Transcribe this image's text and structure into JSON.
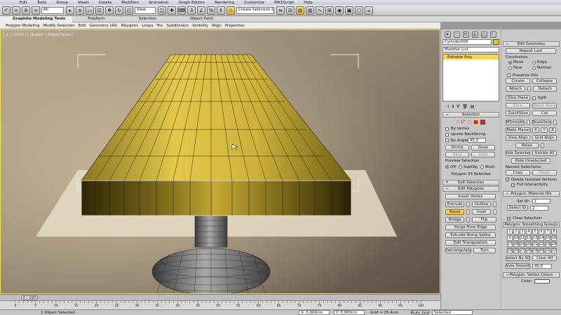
{
  "menu": [
    "Edit",
    "Tools",
    "Group",
    "Views",
    "Create",
    "Modifiers",
    "Animation",
    "Graph Editors",
    "Rendering",
    "Customize",
    "MAXScript",
    "Help"
  ],
  "toolbar": {
    "filter_select": "All",
    "coord_select": "View",
    "selection_set_placeholder": "Create Selection Se"
  },
  "ribbon": {
    "tabs": [
      "Graphite Modeling Tools",
      "Freeform",
      "Selection",
      "Object Paint"
    ],
    "subtabs": [
      "Polygon Modeling",
      "Modify Selection",
      "Edit",
      "Geometry (All)",
      "Polygons",
      "Loops",
      "Tris",
      "Subdivision",
      "Visibility",
      "Align",
      "Properties"
    ]
  },
  "viewport": {
    "label": "[ + ] [ Front ] [ Shaded + Edged Faces ]",
    "lampshade_color": "#d4b93a",
    "lampshade_dark": "#6a5a10",
    "base_color": "#7a7a7a"
  },
  "modify_panel": {
    "object_name": "Cylinder008",
    "modifier_list": "Modifier List",
    "stack_item": "Editable Poly",
    "selection": {
      "title": "Selection",
      "by_vertex": "By Vertex",
      "ignore_backfacing": "Ignore Backfacing",
      "by_angle": "By Angle:",
      "by_angle_value": "45,0",
      "shrink": "Shrink",
      "grow": "Grow",
      "ring": "Ring",
      "loop": "Loop",
      "preview_selection": "Preview Selection",
      "off": "Off",
      "subobj": "SubObj",
      "multi": "Multi",
      "status": "Polygon 33 Selected"
    },
    "soft_selection": "Soft Selection",
    "edit_polygons": {
      "title": "Edit Polygons",
      "insert_vertex": "Insert Vertex",
      "extrude": "Extrude",
      "outline": "Outline",
      "bevel": "Bevel",
      "inset": "Inset",
      "bridge": "Bridge",
      "flip": "Flip",
      "hinge": "Hinge From Edge",
      "extrude_spline": "Extrude Along Spline",
      "edit_triangulation": "Edit Triangulation",
      "retriangulate": "Retriangulate",
      "turn": "Turn"
    }
  },
  "edit_geometry": {
    "title": "Edit Geometry",
    "repeat_last": "Repeat Last",
    "constraints": "Constraints",
    "none": "None",
    "edge": "Edge",
    "face": "Face",
    "normal": "Normal",
    "preserve_uvs": "Preserve UVs",
    "create": "Create",
    "collapse": "Collapse",
    "attach": "Attach",
    "detach": "Detach",
    "slice_plane": "Slice Plane",
    "split": "Split",
    "slice": "Slice",
    "reset_plane": "Reset Plane",
    "quickslice": "QuickSlice",
    "cut": "Cut",
    "msmooth": "MSmooth",
    "tessellate": "Tessellate",
    "make_planar": "Make Planar",
    "x": "X",
    "y": "Y",
    "z": "Z",
    "view_align": "View Align",
    "grid_align": "Grid Align",
    "relax": "Relax",
    "hide_selected": "Hide Selected",
    "unhide_all": "Unhide All",
    "hide_unselected": "Hide Unselected",
    "named_selections": "Named Selections:",
    "copy": "Copy",
    "paste": "Paste",
    "delete_isolated": "Delete Isolated Vertices",
    "full_interactivity": "Full Interactivity"
  },
  "material_ids": {
    "title": "Polygon: Material IDs",
    "set_id": "Set ID:",
    "set_id_value": "2",
    "select_id": "Select ID",
    "select_id_value": "2",
    "clear_selection": "Clear Selection"
  },
  "smoothing_groups": {
    "title": "Polygon: Smoothing Groups",
    "numbers": [
      "1",
      "2",
      "3",
      "4",
      "5",
      "6",
      "7",
      "8",
      "9",
      "10",
      "11",
      "12",
      "13",
      "14",
      "15",
      "16",
      "17",
      "18",
      "19",
      "20",
      "21",
      "22",
      "23",
      "24",
      "25",
      "26",
      "27",
      "28",
      "29",
      "30",
      "31",
      "32"
    ],
    "select_by_sg": "Select By SG",
    "clear_all": "Clear All",
    "auto_smooth": "Auto Smooth",
    "auto_smooth_value": "45,0"
  },
  "vertex_colors": {
    "title": "Polygon: Vertex Colors",
    "color": "Color:"
  },
  "timeline": {
    "frame": "0 / 100",
    "ticks": [
      "0",
      "5",
      "10",
      "15",
      "20",
      "25",
      "30",
      "35",
      "40",
      "45",
      "50",
      "55",
      "60",
      "65",
      "70",
      "75",
      "80",
      "85",
      "90",
      "95",
      "100"
    ]
  },
  "status": {
    "selection": "1 Object Selected",
    "x": "X: 0,000cm",
    "y": "Y: 0,000cm",
    "grid": "Grid = 25,4cm",
    "auto_key": "Auto Key",
    "selected": "Selected"
  }
}
